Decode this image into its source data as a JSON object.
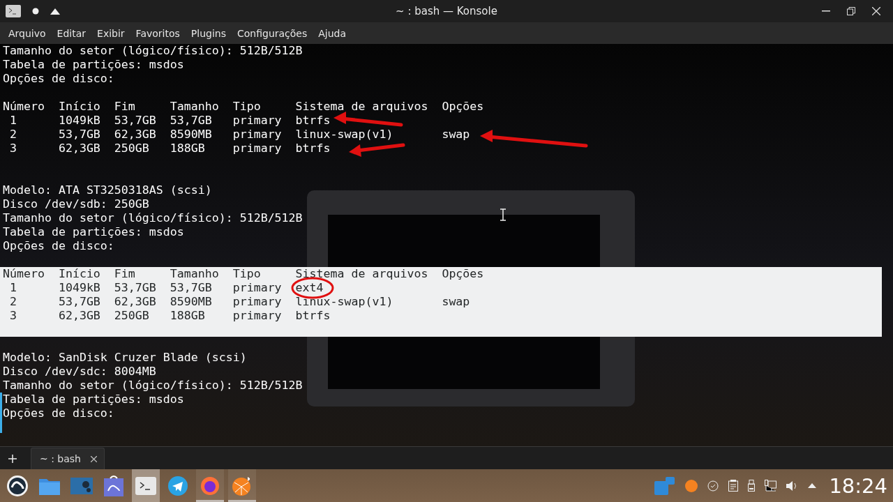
{
  "window": {
    "title": "~ : bash — Konsole"
  },
  "menu": [
    "Arquivo",
    "Editar",
    "Exibir",
    "Favoritos",
    "Plugins",
    "Configurações",
    "Ajuda"
  ],
  "terminal": {
    "lines": [
      {
        "kind": "text",
        "text": "Tamanho do setor (lógico/físico): 512B/512B",
        "selected": false
      },
      {
        "kind": "text",
        "text": "Tabela de partições: msdos",
        "selected": false
      },
      {
        "kind": "text",
        "text": "Opções de disco:",
        "selected": false
      },
      {
        "kind": "blank",
        "selected": false
      },
      {
        "kind": "text",
        "text": "Número  Início  Fim     Tamanho  Tipo     Sistema de arquivos  Opções",
        "selected": false
      },
      {
        "kind": "text",
        "text": " 1      1049kB  53,7GB  53,7GB   primary  btrfs",
        "selected": false
      },
      {
        "kind": "text",
        "text": " 2      53,7GB  62,3GB  8590MB   primary  linux-swap(v1)       swap",
        "selected": false
      },
      {
        "kind": "text",
        "text": " 3      62,3GB  250GB   188GB    primary  btrfs",
        "selected": false
      },
      {
        "kind": "blank",
        "selected": false
      },
      {
        "kind": "blank",
        "selected": false
      },
      {
        "kind": "text",
        "text": "Modelo: ATA ST3250318AS (scsi)",
        "selected": false
      },
      {
        "kind": "text",
        "text": "Disco /dev/sdb: 250GB",
        "selected": false
      },
      {
        "kind": "text",
        "text": "Tamanho do setor (lógico/físico): 512B/512B",
        "selected": false
      },
      {
        "kind": "text",
        "text": "Tabela de partições: msdos",
        "selected": false
      },
      {
        "kind": "text",
        "text": "Opções de disco:",
        "selected": false
      },
      {
        "kind": "blank",
        "selected": false
      },
      {
        "kind": "text",
        "text": "Número  Início  Fim     Tamanho  Tipo     Sistema de arquivos  Opções",
        "selected": true
      },
      {
        "kind": "text",
        "text": " 1      1049kB  53,7GB  53,7GB   primary  ext4",
        "selected": true
      },
      {
        "kind": "text",
        "text": " 2      53,7GB  62,3GB  8590MB   primary  linux-swap(v1)       swap",
        "selected": true
      },
      {
        "kind": "text",
        "text": " 3      62,3GB  250GB   188GB    primary  btrfs",
        "selected": true
      },
      {
        "kind": "blank",
        "selected": true
      },
      {
        "kind": "blank",
        "selected": false
      },
      {
        "kind": "text",
        "text": "Modelo: SanDisk Cruzer Blade (scsi)",
        "selected": false
      },
      {
        "kind": "text",
        "text": "Disco /dev/sdc: 8004MB",
        "selected": false
      },
      {
        "kind": "text",
        "text": "Tamanho do setor (lógico/físico): 512B/512B",
        "selected": false
      },
      {
        "kind": "text",
        "text": "Tabela de partições: msdos",
        "selected": false
      },
      {
        "kind": "text",
        "text": "Opções de disco:",
        "selected": false
      }
    ]
  },
  "tabs": [
    {
      "label": "~ : bash",
      "selected": true
    }
  ],
  "taskbar": {
    "tasks": [
      {
        "selected": false,
        "running": false
      },
      {
        "selected": false,
        "running": false
      },
      {
        "selected": false,
        "running": false
      },
      {
        "selected": false,
        "running": false
      },
      {
        "selected": true,
        "running": false
      },
      {
        "selected": false,
        "running": false
      },
      {
        "selected": false,
        "running": true
      },
      {
        "selected": false,
        "running": true
      }
    ],
    "clock": "18:24"
  }
}
